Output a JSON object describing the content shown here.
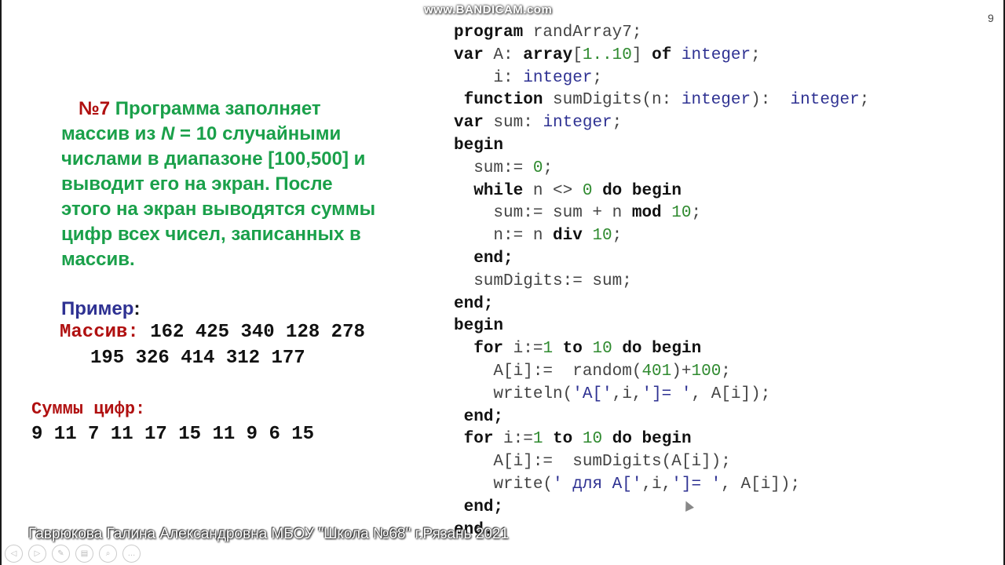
{
  "watermark": "www.BANDICAM.com",
  "slide_number": "9",
  "task": {
    "number": "№7",
    "line1": " Программа  заполняет",
    "line2a": "массив из  ",
    "line2n": "N",
    "line2b": " = 10 случайными",
    "line3": "числами в диапазоне [100,500] и",
    "line4": "выводит его на экран. После",
    "line5": "этого на экран выводятся суммы",
    "line6": "цифр всех чисел, записанных в",
    "line7": "массив."
  },
  "example": {
    "label": "Пример",
    "colon": ":",
    "array_label": "Массив:",
    "array_row1": " 162 425 340 128 278",
    "array_row2": "195 326 414 312 177",
    "array_values": [
      162,
      425,
      340,
      128,
      278,
      195,
      326,
      414,
      312,
      177
    ],
    "sums_label": "Суммы цифр:",
    "sums_text": "9 11 7 11 17 15 11 9 6 15",
    "sums_values": [
      9,
      11,
      7,
      11,
      17,
      15,
      11,
      9,
      6,
      15
    ]
  },
  "code": [
    [
      {
        "t": "program",
        "c": "kw"
      },
      {
        "t": " randArray7;"
      }
    ],
    [
      {
        "t": "var",
        "c": "kw"
      },
      {
        "t": " A: "
      },
      {
        "t": "array",
        "c": "kw"
      },
      {
        "t": "["
      },
      {
        "t": "1..10",
        "c": "nm"
      },
      {
        "t": "] "
      },
      {
        "t": "of",
        "c": "kw"
      },
      {
        "t": " "
      },
      {
        "t": "integer",
        "c": "ty"
      },
      {
        "t": ";"
      }
    ],
    [
      {
        "t": "    i: "
      },
      {
        "t": "integer",
        "c": "ty"
      },
      {
        "t": ";"
      }
    ],
    [
      {
        "t": " "
      },
      {
        "t": "function",
        "c": "kw"
      },
      {
        "t": " sumDigits(n: "
      },
      {
        "t": "integer",
        "c": "ty"
      },
      {
        "t": "):  "
      },
      {
        "t": "integer",
        "c": "ty"
      },
      {
        "t": ";"
      }
    ],
    [
      {
        "t": "var",
        "c": "kw"
      },
      {
        "t": " sum: "
      },
      {
        "t": "integer",
        "c": "ty"
      },
      {
        "t": ";"
      }
    ],
    [
      {
        "t": "begin",
        "c": "kw"
      }
    ],
    [
      {
        "t": "  sum:= "
      },
      {
        "t": "0",
        "c": "nm"
      },
      {
        "t": ";"
      }
    ],
    [
      {
        "t": "  "
      },
      {
        "t": "while",
        "c": "kw"
      },
      {
        "t": " n <> "
      },
      {
        "t": "0",
        "c": "nm"
      },
      {
        "t": " "
      },
      {
        "t": "do",
        "c": "kw"
      },
      {
        "t": " "
      },
      {
        "t": "begin",
        "c": "kw"
      }
    ],
    [
      {
        "t": "    sum:= sum + n "
      },
      {
        "t": "mod",
        "c": "kw"
      },
      {
        "t": " "
      },
      {
        "t": "10",
        "c": "nm"
      },
      {
        "t": ";"
      }
    ],
    [
      {
        "t": "    n:= n "
      },
      {
        "t": "div",
        "c": "kw"
      },
      {
        "t": " "
      },
      {
        "t": "10",
        "c": "nm"
      },
      {
        "t": ";"
      }
    ],
    [
      {
        "t": "  "
      },
      {
        "t": "end;",
        "c": "kw"
      }
    ],
    [
      {
        "t": "  sumDigits:= sum;"
      }
    ],
    [
      {
        "t": "end;",
        "c": "kw"
      }
    ],
    [
      {
        "t": "begin",
        "c": "kw"
      }
    ],
    [
      {
        "t": "  "
      },
      {
        "t": "for",
        "c": "kw"
      },
      {
        "t": " i:="
      },
      {
        "t": "1",
        "c": "nm"
      },
      {
        "t": " "
      },
      {
        "t": "to",
        "c": "kw"
      },
      {
        "t": " "
      },
      {
        "t": "10",
        "c": "nm"
      },
      {
        "t": " "
      },
      {
        "t": "do",
        "c": "kw"
      },
      {
        "t": " "
      },
      {
        "t": "begin",
        "c": "kw"
      }
    ],
    [
      {
        "t": "    A[i]:=  random("
      },
      {
        "t": "401",
        "c": "nm"
      },
      {
        "t": ")+"
      },
      {
        "t": "100",
        "c": "nm"
      },
      {
        "t": ";"
      }
    ],
    [
      {
        "t": "    writeln("
      },
      {
        "t": "'A['",
        "c": "st"
      },
      {
        "t": ",i,"
      },
      {
        "t": "']= '",
        "c": "st"
      },
      {
        "t": ", A[i]);"
      }
    ],
    [
      {
        "t": " "
      },
      {
        "t": "end;",
        "c": "kw"
      }
    ],
    [
      {
        "t": " "
      },
      {
        "t": "for",
        "c": "kw"
      },
      {
        "t": " i:="
      },
      {
        "t": "1",
        "c": "nm"
      },
      {
        "t": " "
      },
      {
        "t": "to",
        "c": "kw"
      },
      {
        "t": " "
      },
      {
        "t": "10",
        "c": "nm"
      },
      {
        "t": " "
      },
      {
        "t": "do",
        "c": "kw"
      },
      {
        "t": " "
      },
      {
        "t": "begin",
        "c": "kw"
      }
    ],
    [
      {
        "t": "    A[i]:=  sumDigits(A[i]);"
      }
    ],
    [
      {
        "t": "    write("
      },
      {
        "t": "' для A['",
        "c": "st"
      },
      {
        "t": ",i,"
      },
      {
        "t": "']= '",
        "c": "st"
      },
      {
        "t": ", A[i]);"
      }
    ],
    [
      {
        "t": " "
      },
      {
        "t": "end;",
        "c": "kw"
      }
    ],
    [
      {
        "t": "end.",
        "c": "kw"
      }
    ]
  ],
  "footer": "Гаврюкова Галина Александровна МБОУ \"Школа №68\" г.Рязань 2021",
  "nav_icons": [
    {
      "name": "previous-slide-icon",
      "glyph": "◁"
    },
    {
      "name": "next-slide-icon",
      "glyph": "▷"
    },
    {
      "name": "pen-icon",
      "glyph": "✎"
    },
    {
      "name": "slides-icon",
      "glyph": "▤"
    },
    {
      "name": "zoom-icon",
      "glyph": "⌕"
    },
    {
      "name": "more-icon",
      "glyph": "…"
    }
  ]
}
